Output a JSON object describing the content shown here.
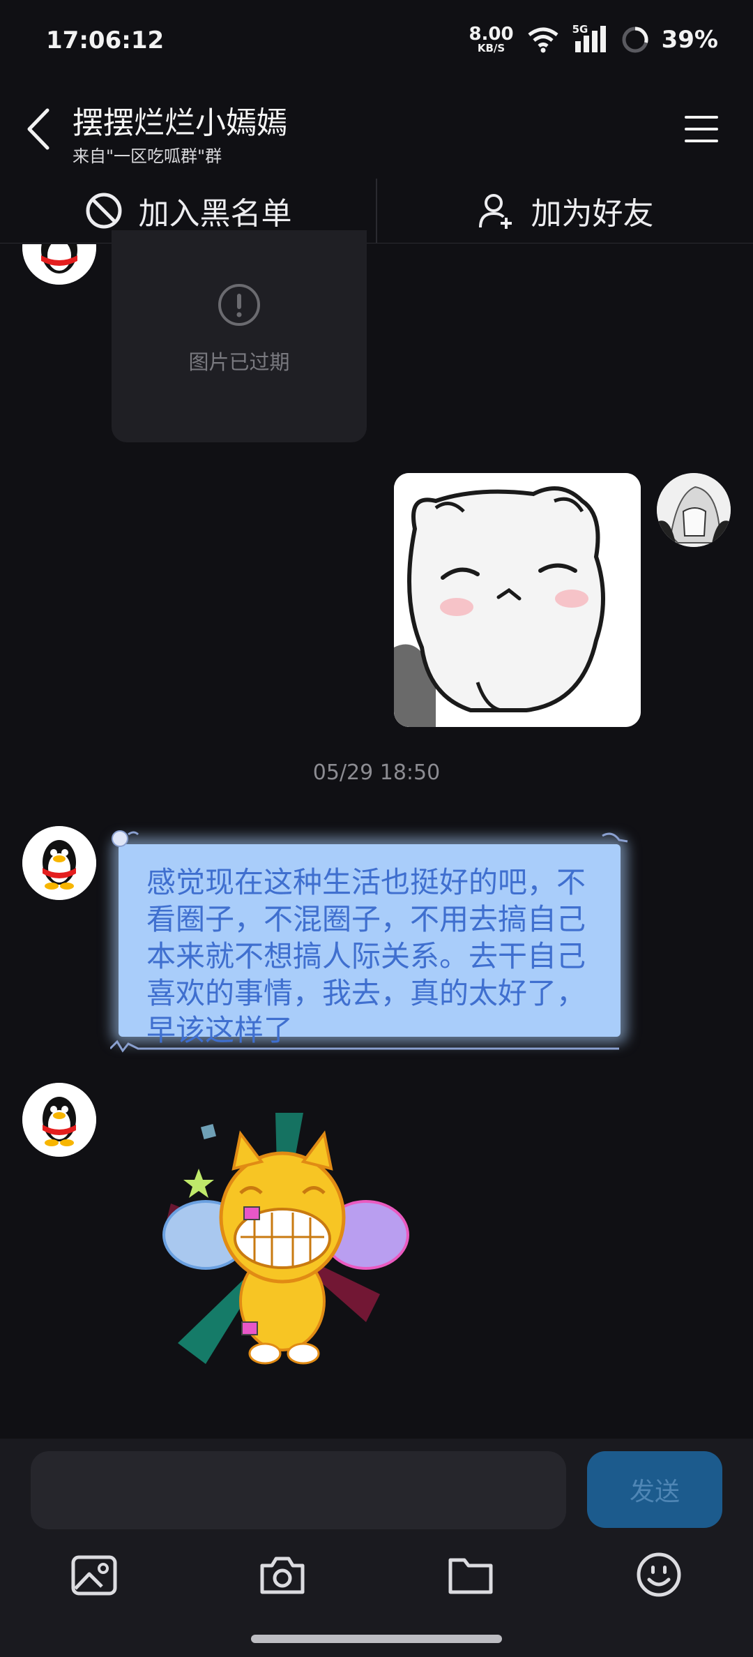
{
  "status_bar": {
    "time": "17:06:12",
    "net_speed_value": "8.00",
    "net_speed_unit": "KB/S",
    "signal_label": "5G",
    "battery_percent": "39%"
  },
  "header": {
    "title": "摆摆烂烂小嫣嫣",
    "subtitle": "来自\"一区吃呱群\"群"
  },
  "actions": {
    "blacklist_label": "加入黑名单",
    "add_friend_label": "加为好友"
  },
  "messages": {
    "expired_image_text": "图片已过期",
    "timestamp": "05/29 18:50",
    "text_message": "感觉现在这种生活也挺好的吧，不看圈子，不混圈子，不用去搞自己本来就不想搞人际关系。去干自己喜欢的事情，我去，真的太好了，早该这样了"
  },
  "composer": {
    "input_value": "",
    "send_label": "发送"
  },
  "colors": {
    "background": "#101014",
    "bubble": "#a9cdfa",
    "bubble_text": "#3f6fcf",
    "send_button": "#1c5b8d"
  }
}
